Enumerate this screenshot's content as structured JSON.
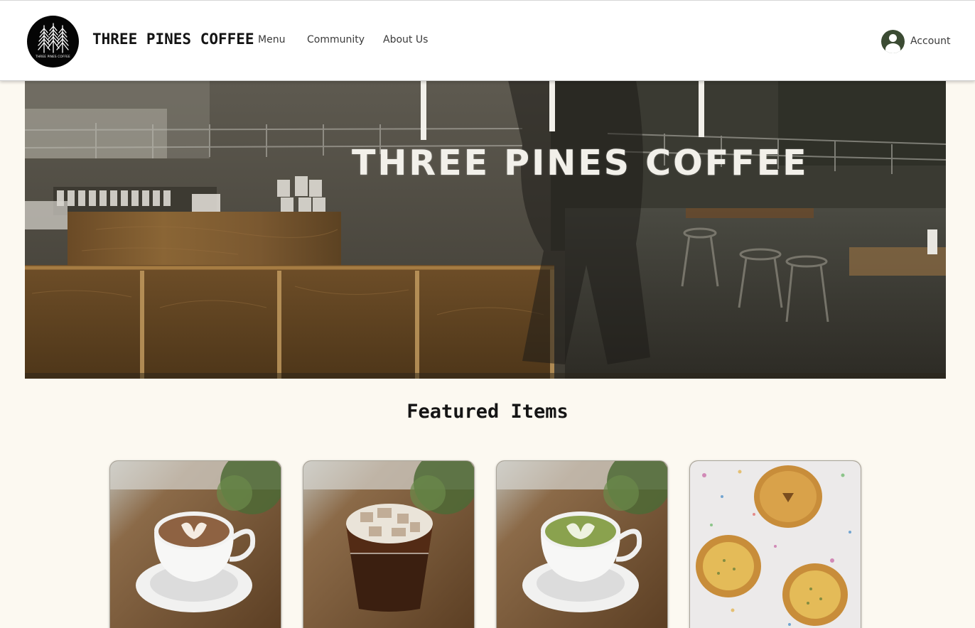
{
  "header": {
    "brand": "THREE PINES COFFEE",
    "logo_text": "THREE PINES COFFEE",
    "nav": [
      {
        "label": "Menu"
      },
      {
        "label": "Community"
      },
      {
        "label": "About Us"
      }
    ],
    "account_label": "Account"
  },
  "hero": {
    "sign_text": "THREE PINES COFFEE"
  },
  "featured": {
    "title": "Featured Items"
  },
  "colors": {
    "page_bg": "#fcf9f1",
    "header_bg": "#ffffff",
    "account_icon": "#3b4b33",
    "text_dark": "#141414",
    "nav_text": "#3a3a3a"
  },
  "icons": {
    "logo": "pine-trees-logo-icon",
    "account": "user-avatar-icon"
  }
}
